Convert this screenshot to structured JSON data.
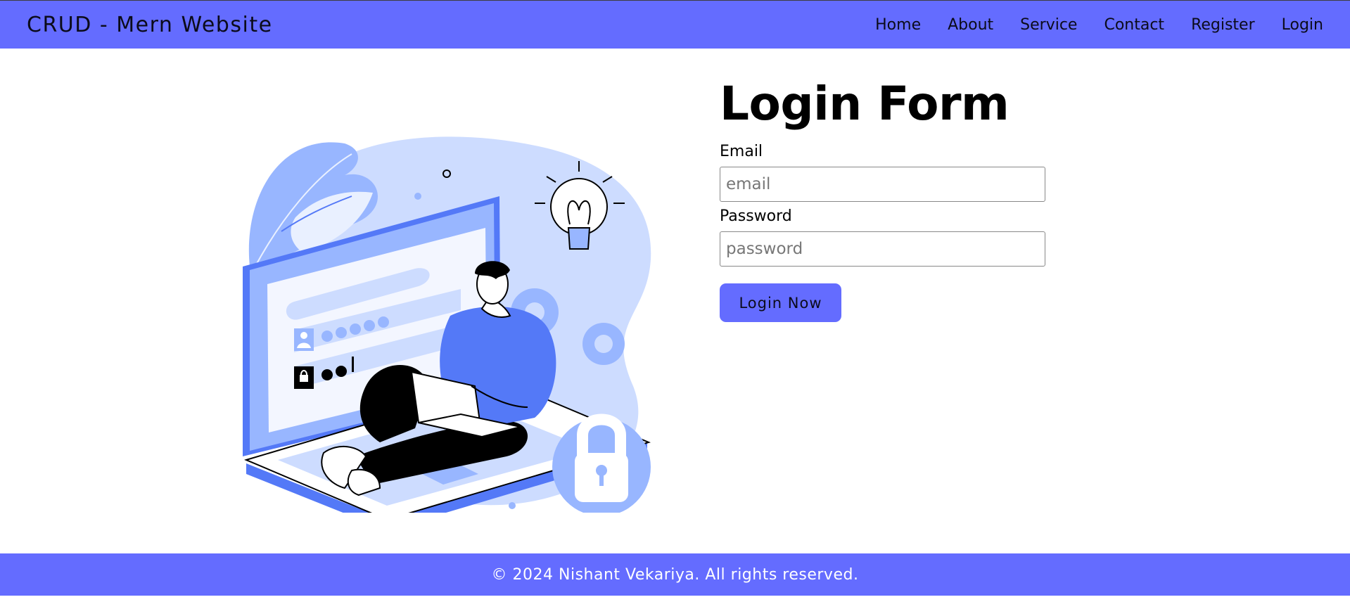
{
  "header": {
    "brand": "CRUD - Mern Website",
    "nav": [
      {
        "label": "Home"
      },
      {
        "label": "About"
      },
      {
        "label": "Service"
      },
      {
        "label": "Contact"
      },
      {
        "label": "Register"
      },
      {
        "label": "Login"
      }
    ]
  },
  "form": {
    "title": "Login Form",
    "email_label": "Email",
    "email_placeholder": "email",
    "password_label": "Password",
    "password_placeholder": "password",
    "submit_label": "Login Now"
  },
  "footer": {
    "text": "© 2024 Nishant Vekariya. All rights reserved."
  },
  "colors": {
    "accent": "#646cff",
    "illustration_light": "#cddcff",
    "illustration_mid": "#98b6ff",
    "illustration_dark": "#5479f7"
  }
}
